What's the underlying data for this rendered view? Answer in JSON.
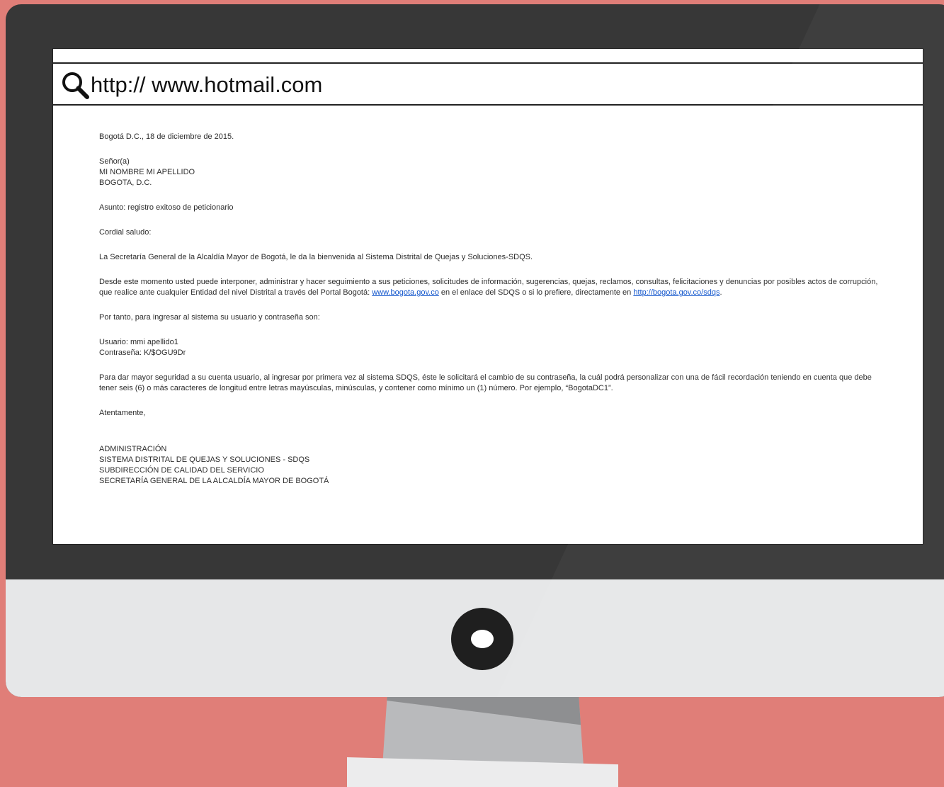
{
  "browser": {
    "url": "http:// www.hotmail.com"
  },
  "email": {
    "date_line": "Bogotá D.C., 18 de diciembre de 2015.",
    "recipient": {
      "salutation": "Señor(a)",
      "name": "MI NOMBRE MI APELLIDO",
      "city": "BOGOTA, D.C."
    },
    "subject": "Asunto: registro exitoso de peticionario",
    "greeting": "Cordial saludo:",
    "welcome": "La Secretaría General de la Alcaldía Mayor de Bogotá, le da la bienvenida al Sistema Distrital de Quejas y Soluciones-SDQS.",
    "info": {
      "text_1": "Desde este momento usted puede interponer, administrar y hacer seguimiento a sus peticiones, solicitudes de información, sugerencias, quejas, reclamos, consultas, felicitaciones y denuncias por posibles actos de corrupción, que realice ante cualquier Entidad del nivel Distrital a través del Portal Bogotá: ",
      "link_1": "www.bogota.gov.co",
      "text_2": " en el enlace del SDQS o si lo prefiere, directamente en ",
      "link_2": "http://bogota.gov.co/sdqs",
      "text_3": "."
    },
    "credentials_intro": "Por tanto, para ingresar al sistema su usuario y contraseña son:",
    "username_line": "Usuario: mmi apellido1",
    "password_line": "Contraseña: K/$OGU9Dr",
    "security_note": "Para dar mayor seguridad a su cuenta usuario, al ingresar por primera vez al sistema SDQS, éste le solicitará el cambio de su contraseña, la cuál podrá personalizar con una de fácil recordación teniendo en cuenta que debe tener seis (6) o más caracteres de longitud entre letras mayúsculas, minúsculas, y contener como mínimo un (1) número. Por ejemplo, “BogotaDC1”.",
    "closing": "Atentamente,",
    "signature": [
      "ADMINISTRACIÓN",
      "SISTEMA DISTRITAL DE QUEJAS Y SOLUCIONES - SDQS",
      "SUBDIRECCIÓN DE CALIDAD DEL SERVICIO",
      "SECRETARÍA GENERAL DE LA ALCALDÍA MAYOR DE BOGOTÁ"
    ]
  }
}
